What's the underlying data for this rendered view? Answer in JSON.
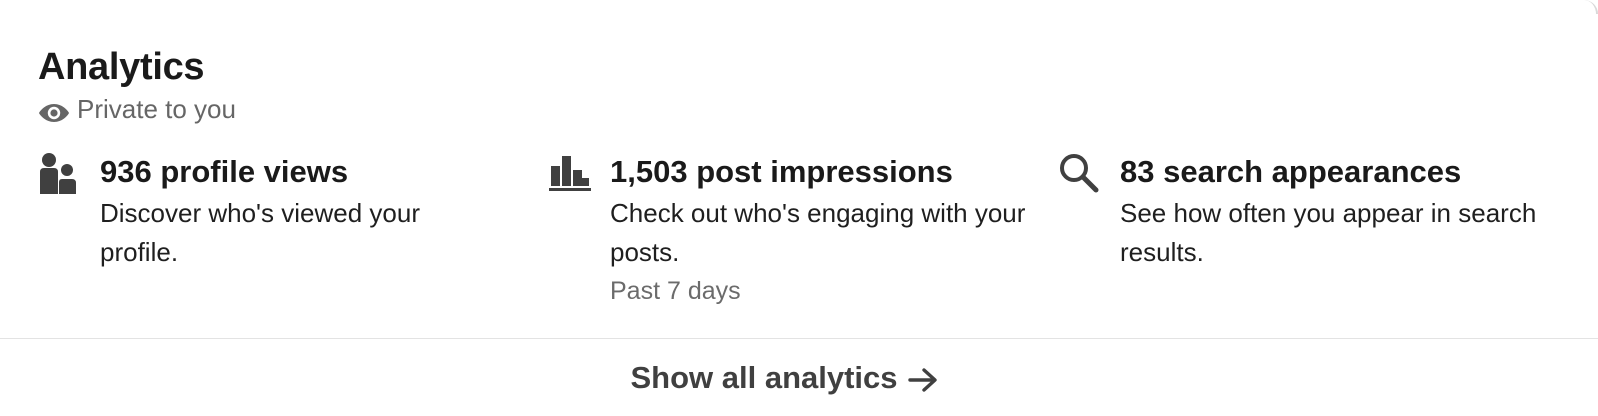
{
  "card": {
    "title": "Analytics",
    "privacy_label": "Private to you",
    "privacy_icon": "eye-icon"
  },
  "metrics": [
    {
      "icon": "people-icon",
      "headline": "936 profile views",
      "description": "Discover who's viewed your profile.",
      "subtext": ""
    },
    {
      "icon": "bar-chart-icon",
      "headline": "1,503 post impressions",
      "description": "Check out who's engaging with your posts.",
      "subtext": "Past 7 days"
    },
    {
      "icon": "search-icon",
      "headline": "83 search appearances",
      "description": "See how often you appear in search results.",
      "subtext": ""
    }
  ],
  "footer": {
    "show_all_label": "Show all analytics",
    "arrow_icon": "arrow-right-icon"
  },
  "colors": {
    "text_primary": "#1a1a1a",
    "text_secondary": "#666666",
    "icon": "#404040",
    "divider": "#e3e3e3"
  }
}
